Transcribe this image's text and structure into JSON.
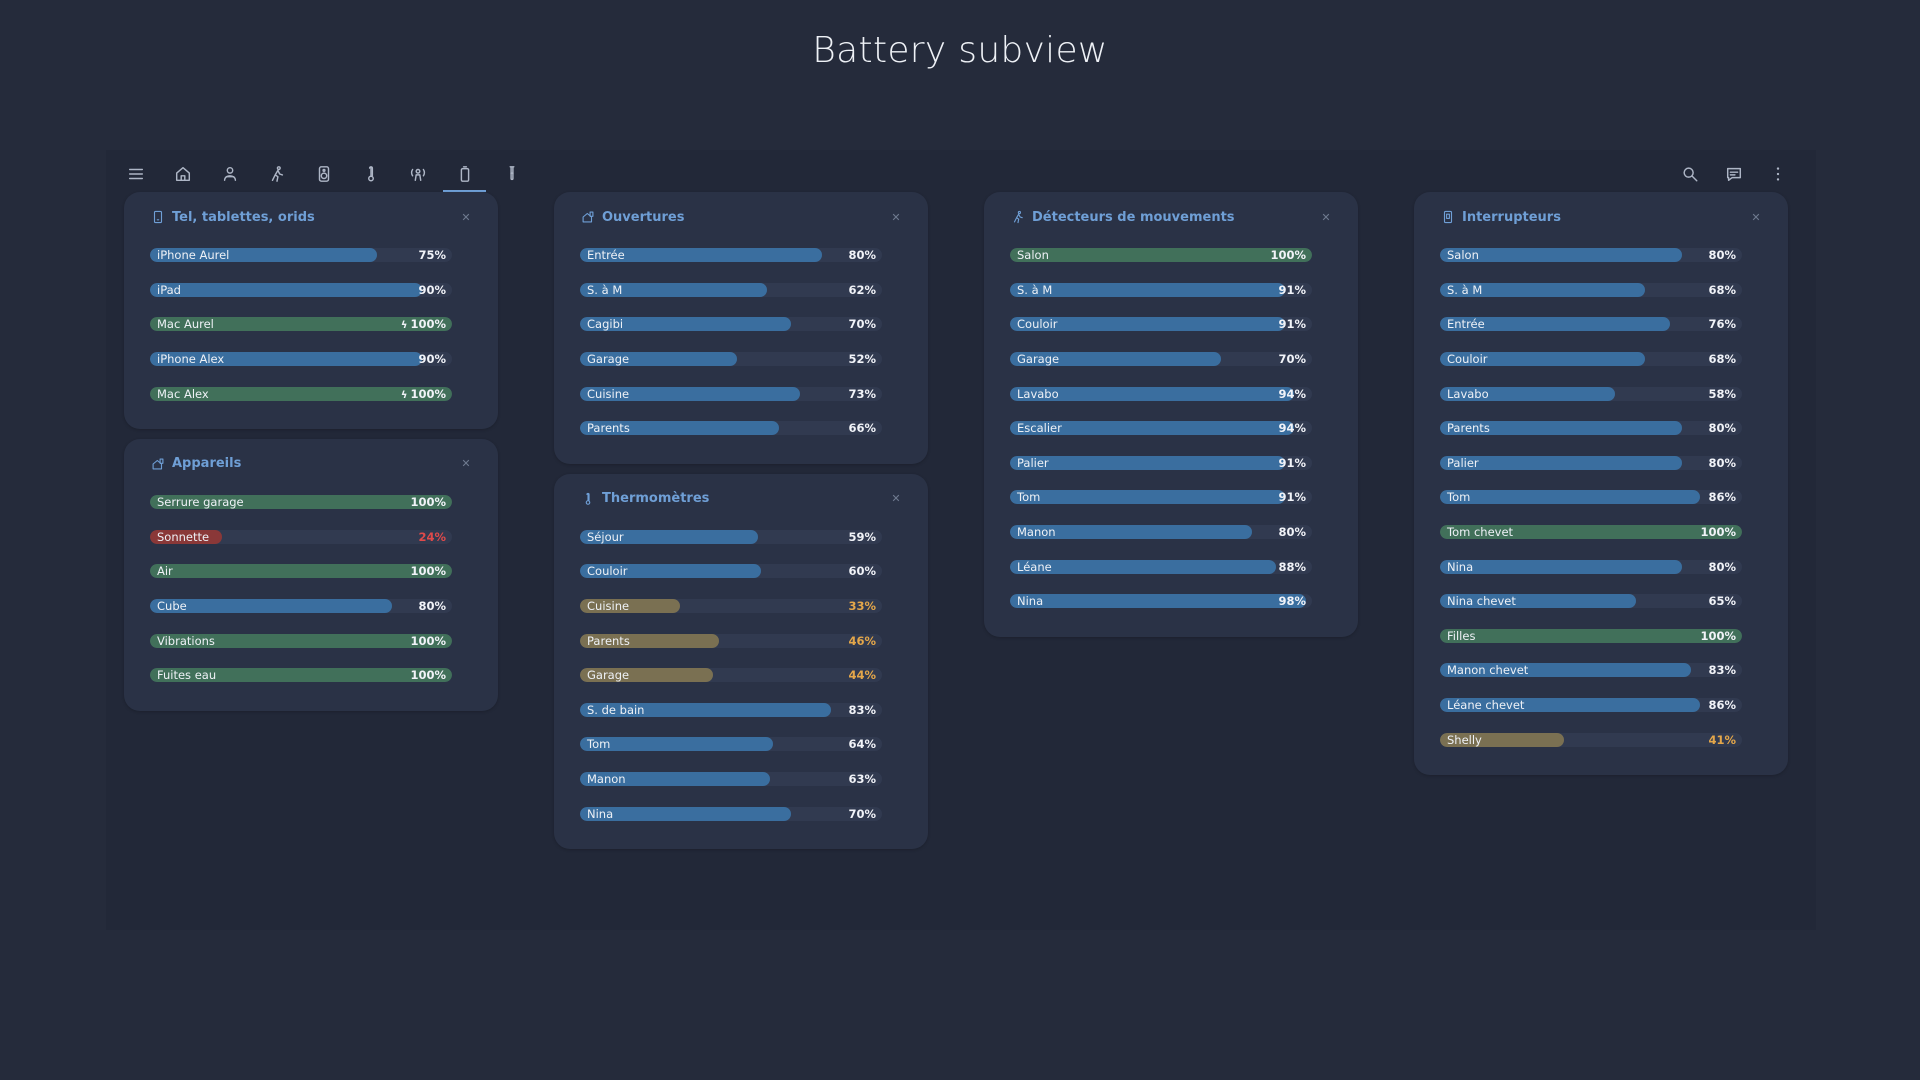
{
  "title": "Battery subview",
  "toolbar": {
    "left": [
      {
        "name": "menu-icon",
        "active": false
      },
      {
        "name": "home-icon",
        "active": false
      },
      {
        "name": "person-icon",
        "active": false
      },
      {
        "name": "walking-icon",
        "active": false
      },
      {
        "name": "speaker-icon",
        "active": false
      },
      {
        "name": "thermometer-icon",
        "active": false
      },
      {
        "name": "presence-icon",
        "active": false
      },
      {
        "name": "battery-icon",
        "active": true
      },
      {
        "name": "test-tube-icon",
        "active": false
      }
    ],
    "right": [
      {
        "name": "search-icon"
      },
      {
        "name": "message-icon"
      },
      {
        "name": "more-vert-icon"
      }
    ]
  },
  "colors": {
    "blue": "#3a6e9f",
    "green": "#41705a",
    "red": "#8a3838",
    "yellow": "#7a7052",
    "title": "#6f9fd6",
    "pct_red": "#e04a4a",
    "pct_orange": "#e4a74a"
  },
  "columns": [
    [
      {
        "title": "Tel, tablettes, orids",
        "icon": "phone-icon",
        "items": [
          {
            "name": "iPhone Aurel",
            "value": 75,
            "label": "75%",
            "color": "blue"
          },
          {
            "name": "iPad",
            "value": 90,
            "label": "90%",
            "color": "blue"
          },
          {
            "name": "Mac Aurel",
            "value": 100,
            "label": "100%",
            "color": "green",
            "charging": true
          },
          {
            "name": "iPhone Alex",
            "value": 90,
            "label": "90%",
            "color": "blue"
          },
          {
            "name": "Mac Alex",
            "value": 100,
            "label": "100%",
            "color": "green",
            "charging": true
          }
        ]
      },
      {
        "title": "Appareils",
        "icon": "home-device-icon",
        "items": [
          {
            "name": "Serrure garage",
            "value": 100,
            "label": "100%",
            "color": "green"
          },
          {
            "name": "Sonnette",
            "value": 24,
            "label": "24%",
            "color": "red"
          },
          {
            "name": "Air",
            "value": 100,
            "label": "100%",
            "color": "green"
          },
          {
            "name": "Cube",
            "value": 80,
            "label": "80%",
            "color": "blue"
          },
          {
            "name": "Vibrations",
            "value": 100,
            "label": "100%",
            "color": "green"
          },
          {
            "name": "Fuites eau",
            "value": 100,
            "label": "100%",
            "color": "green"
          }
        ]
      }
    ],
    [
      {
        "title": "Ouvertures",
        "icon": "home-device-icon",
        "items": [
          {
            "name": "Entrée",
            "value": 80,
            "label": "80%",
            "color": "blue"
          },
          {
            "name": "S. à M",
            "value": 62,
            "label": "62%",
            "color": "blue"
          },
          {
            "name": "Cagibi",
            "value": 70,
            "label": "70%",
            "color": "blue"
          },
          {
            "name": "Garage",
            "value": 52,
            "label": "52%",
            "color": "blue"
          },
          {
            "name": "Cuisine",
            "value": 73,
            "label": "73%",
            "color": "blue"
          },
          {
            "name": "Parents",
            "value": 66,
            "label": "66%",
            "color": "blue"
          }
        ]
      },
      {
        "title": "Thermomètres",
        "icon": "thermometer-icon",
        "items": [
          {
            "name": "Séjour",
            "value": 59,
            "label": "59%",
            "color": "blue"
          },
          {
            "name": "Couloir",
            "value": 60,
            "label": "60%",
            "color": "blue"
          },
          {
            "name": "Cuisine",
            "value": 33,
            "label": "33%",
            "color": "yellow"
          },
          {
            "name": "Parents",
            "value": 46,
            "label": "46%",
            "color": "yellow"
          },
          {
            "name": "Garage",
            "value": 44,
            "label": "44%",
            "color": "yellow"
          },
          {
            "name": "S. de bain",
            "value": 83,
            "label": "83%",
            "color": "blue"
          },
          {
            "name": "Tom",
            "value": 64,
            "label": "64%",
            "color": "blue"
          },
          {
            "name": "Manon",
            "value": 63,
            "label": "63%",
            "color": "blue"
          },
          {
            "name": "Nina",
            "value": 70,
            "label": "70%",
            "color": "blue"
          }
        ]
      }
    ],
    [
      {
        "title": "Détecteurs de mouvements",
        "icon": "walking-icon",
        "items": [
          {
            "name": "Salon",
            "value": 100,
            "label": "100%",
            "color": "green"
          },
          {
            "name": "S. à M",
            "value": 91,
            "label": "91%",
            "color": "blue"
          },
          {
            "name": "Couloir",
            "value": 91,
            "label": "91%",
            "color": "blue"
          },
          {
            "name": "Garage",
            "value": 70,
            "label": "70%",
            "color": "blue"
          },
          {
            "name": "Lavabo",
            "value": 94,
            "label": "94%",
            "color": "blue"
          },
          {
            "name": "Escalier",
            "value": 94,
            "label": "94%",
            "color": "blue"
          },
          {
            "name": "Palier",
            "value": 91,
            "label": "91%",
            "color": "blue"
          },
          {
            "name": "Tom",
            "value": 91,
            "label": "91%",
            "color": "blue"
          },
          {
            "name": "Manon",
            "value": 80,
            "label": "80%",
            "color": "blue"
          },
          {
            "name": "Léane",
            "value": 88,
            "label": "88%",
            "color": "blue"
          },
          {
            "name": "Nina",
            "value": 98,
            "label": "98%",
            "color": "blue"
          }
        ]
      }
    ],
    [
      {
        "title": "Interrupteurs",
        "icon": "switch-icon",
        "items": [
          {
            "name": "Salon",
            "value": 80,
            "label": "80%",
            "color": "blue"
          },
          {
            "name": "S. à M",
            "value": 68,
            "label": "68%",
            "color": "blue"
          },
          {
            "name": "Entrée",
            "value": 76,
            "label": "76%",
            "color": "blue"
          },
          {
            "name": "Couloir",
            "value": 68,
            "label": "68%",
            "color": "blue"
          },
          {
            "name": "Lavabo",
            "value": 58,
            "label": "58%",
            "color": "blue"
          },
          {
            "name": "Parents",
            "value": 80,
            "label": "80%",
            "color": "blue"
          },
          {
            "name": "Palier",
            "value": 80,
            "label": "80%",
            "color": "blue"
          },
          {
            "name": "Tom",
            "value": 86,
            "label": "86%",
            "color": "blue"
          },
          {
            "name": "Tom chevet",
            "value": 100,
            "label": "100%",
            "color": "green"
          },
          {
            "name": "Nina",
            "value": 80,
            "label": "80%",
            "color": "blue"
          },
          {
            "name": "Nina chevet",
            "value": 65,
            "label": "65%",
            "color": "blue"
          },
          {
            "name": "Filles",
            "value": 100,
            "label": "100%",
            "color": "green"
          },
          {
            "name": "Manon chevet",
            "value": 83,
            "label": "83%",
            "color": "blue"
          },
          {
            "name": "Léane chevet",
            "value": 86,
            "label": "86%",
            "color": "blue"
          },
          {
            "name": "Shelly",
            "value": 41,
            "label": "41%",
            "color": "yellow"
          }
        ]
      }
    ]
  ]
}
